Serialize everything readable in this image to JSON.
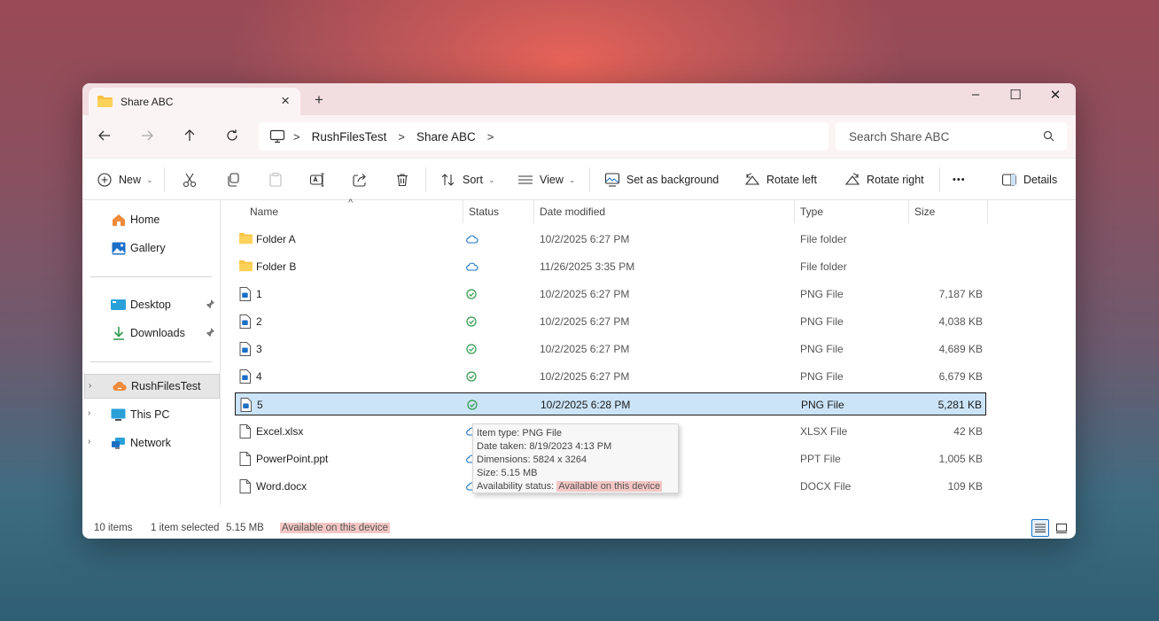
{
  "window": {
    "tab_title": "Share ABC",
    "close_tab": "×",
    "new_tab": "+",
    "minimize": "–",
    "maximize": "☐",
    "close": "✕"
  },
  "nav": {
    "breadcrumbs": [
      "RushFilesTest",
      "Share ABC"
    ],
    "separator": ">",
    "search_placeholder": "Search Share ABC"
  },
  "toolbar": {
    "new": "New",
    "sort": "Sort",
    "view": "View",
    "set_background": "Set as background",
    "rotate_left": "Rotate left",
    "rotate_right": "Rotate right",
    "more": "•••",
    "details": "Details"
  },
  "sidebar": {
    "items": [
      {
        "label": "Home",
        "icon": "home-icon"
      },
      {
        "label": "Gallery",
        "icon": "gallery-icon"
      },
      {
        "label": "Desktop",
        "icon": "desktop-icon"
      },
      {
        "label": "Downloads",
        "icon": "downloads-icon"
      },
      {
        "label": "RushFilesTest",
        "icon": "cloud-drive-icon"
      },
      {
        "label": "This PC",
        "icon": "computer-icon"
      },
      {
        "label": "Network",
        "icon": "network-icon"
      }
    ]
  },
  "columns": {
    "name": "Name",
    "status": "Status",
    "date": "Date modified",
    "type": "Type",
    "size": "Size"
  },
  "files": [
    {
      "name": "Folder A",
      "status": "cloud",
      "date": "10/2/2025 6:27 PM",
      "type": "File folder",
      "size": "",
      "icon": "folder-icon"
    },
    {
      "name": "Folder B",
      "status": "cloud",
      "date": "11/26/2025 3:35 PM",
      "type": "File folder",
      "size": "",
      "icon": "folder-icon"
    },
    {
      "name": "1",
      "status": "available",
      "date": "10/2/2025 6:27 PM",
      "type": "PNG File",
      "size": "7,187 KB",
      "icon": "png-file-icon"
    },
    {
      "name": "2",
      "status": "available",
      "date": "10/2/2025 6:27 PM",
      "type": "PNG File",
      "size": "4,038 KB",
      "icon": "png-file-icon"
    },
    {
      "name": "3",
      "status": "available",
      "date": "10/2/2025 6:27 PM",
      "type": "PNG File",
      "size": "4,689 KB",
      "icon": "png-file-icon"
    },
    {
      "name": "4",
      "status": "available",
      "date": "10/2/2025 6:27 PM",
      "type": "PNG File",
      "size": "6,679 KB",
      "icon": "png-file-icon"
    },
    {
      "name": "5",
      "status": "available",
      "date": "10/2/2025 6:28 PM",
      "type": "PNG File",
      "size": "5,281 KB",
      "icon": "png-file-icon",
      "selected": true
    },
    {
      "name": "Excel.xlsx",
      "status": "cloud",
      "date": "",
      "type": "XLSX File",
      "size": "42 KB",
      "icon": "document-icon"
    },
    {
      "name": "PowerPoint.ppt",
      "status": "cloud",
      "date": "",
      "type": "PPT File",
      "size": "1,005 KB",
      "icon": "document-icon"
    },
    {
      "name": "Word.docx",
      "status": "cloud",
      "date": "",
      "type": "DOCX File",
      "size": "109 KB",
      "icon": "document-icon"
    }
  ],
  "tooltip": {
    "item_type": "Item type: PNG File",
    "date_taken": "Date taken: 8/19/2023 4:13 PM",
    "dimensions": "Dimensions: 5824 x 3264",
    "size": "Size: 5.15 MB",
    "availability_label": "Availability status:",
    "availability_value": "Available on this device"
  },
  "statusbar": {
    "count": "10 items",
    "selected": "1 item selected",
    "size": "5.15 MB",
    "availability": "Available on this device"
  },
  "colors": {
    "selection": "#cce4f7",
    "available_green": "#2e9a4b",
    "cloud_blue": "#1a73c9",
    "highlight_pink": "#f4c7c4",
    "folder_yellow": "#f6c343"
  }
}
